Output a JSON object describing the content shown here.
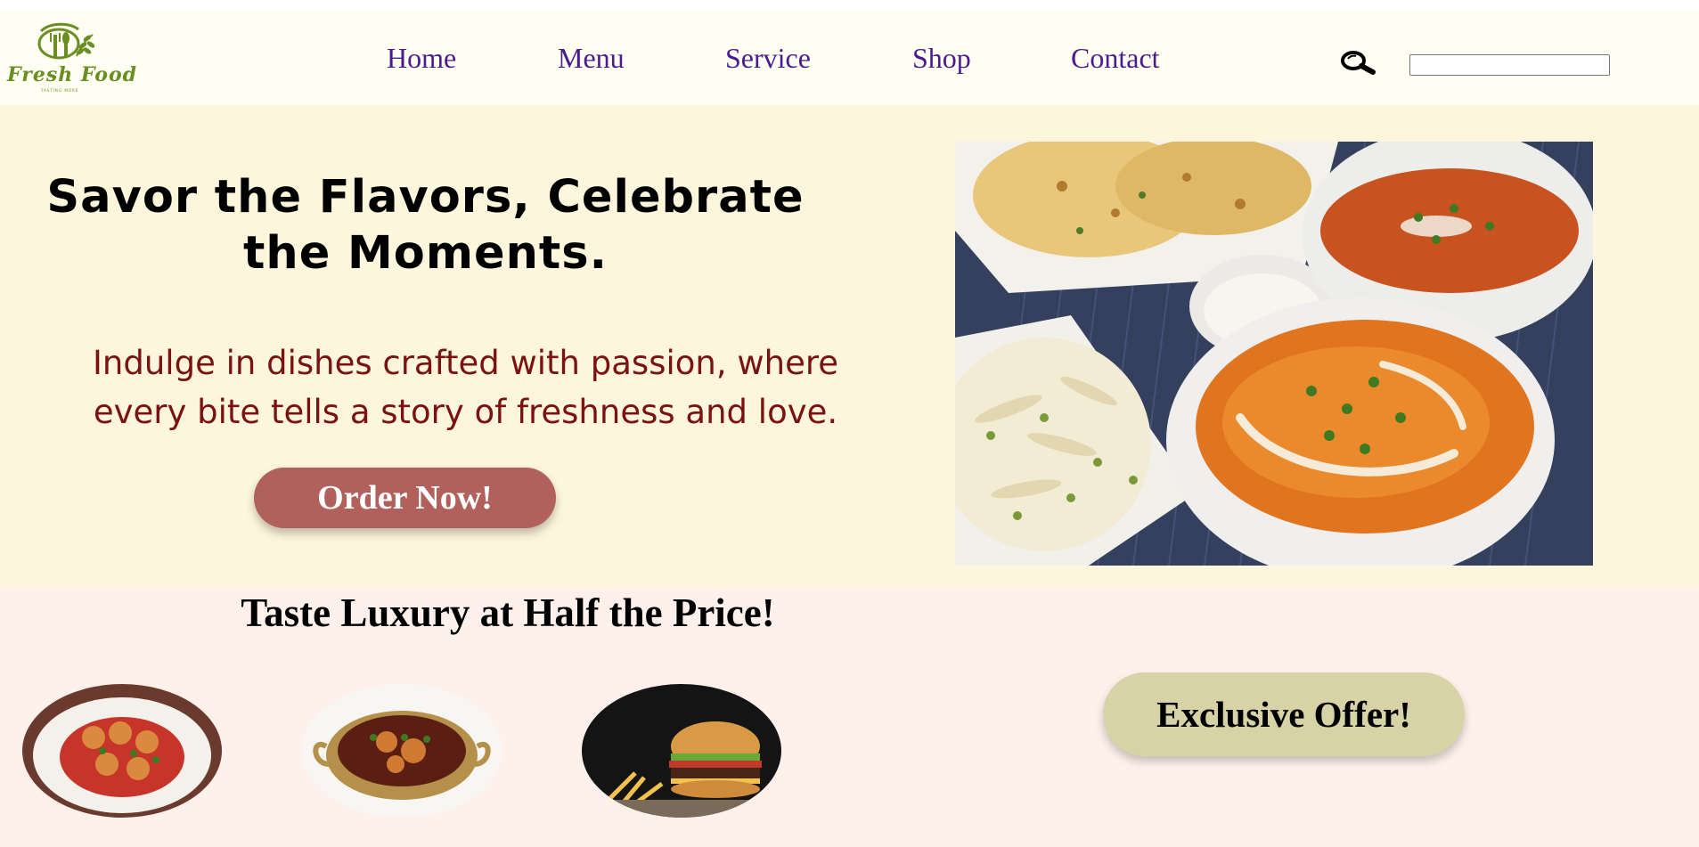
{
  "header": {
    "logo": {
      "name": "Fresh Food",
      "tagline": "TASTING MORE",
      "icon": "fork-spoon-leaf-logo"
    },
    "nav": [
      {
        "label": "Home"
      },
      {
        "label": "Menu"
      },
      {
        "label": "Service"
      },
      {
        "label": "Shop"
      },
      {
        "label": "Contact"
      }
    ],
    "search": {
      "icon": "search-icon",
      "value": "",
      "placeholder": ""
    }
  },
  "hero": {
    "title": "Savor the Flavors, Celebrate the Moments.",
    "subtitle": "Indulge in dishes crafted with passion, where every bite tells a story of freshness and love.",
    "cta_label": "Order Now!",
    "image": "indian-curry-platter-photo"
  },
  "promo": {
    "title": "Taste Luxury at Half the Price!",
    "dishes": [
      {
        "image": "meatball-dish-photo"
      },
      {
        "image": "curry-bowl-photo"
      },
      {
        "image": "burger-fries-photo"
      }
    ],
    "offer_label": "Exclusive Offer!"
  },
  "colors": {
    "header_bg": "#fefef2",
    "hero_bg": "#fef6dc",
    "promo_bg": "#fef1ec",
    "nav_text": "#4b1a8f",
    "subtitle_text": "#7a1212",
    "order_button": "#b1605b",
    "offer_button": "#d7d3a6",
    "logo_green": "#6b8e23"
  }
}
